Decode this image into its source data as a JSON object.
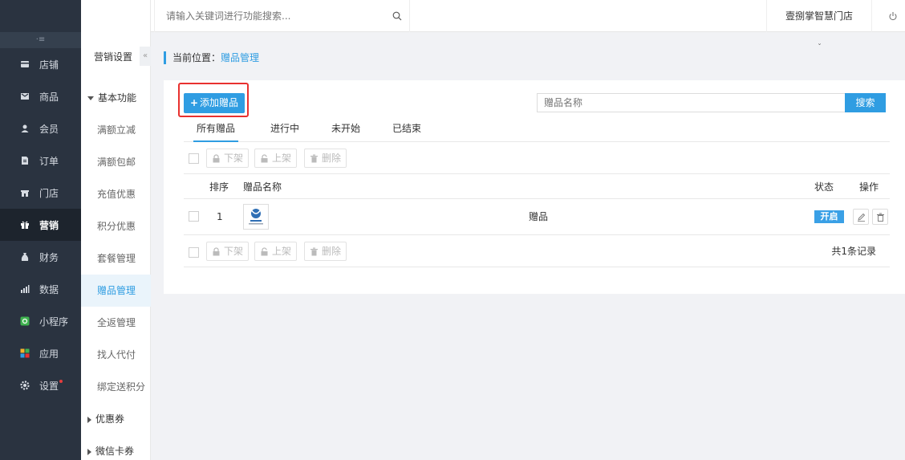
{
  "topbar": {
    "search_placeholder": "请输入关键词进行功能搜索...",
    "store_name": "壹捌掌智慧门店"
  },
  "sidebar": {
    "items": [
      {
        "label": "店铺",
        "icon": "store-icon"
      },
      {
        "label": "商品",
        "icon": "goods-icon"
      },
      {
        "label": "会员",
        "icon": "user-icon"
      },
      {
        "label": "订单",
        "icon": "order-icon"
      },
      {
        "label": "门店",
        "icon": "shop-icon"
      },
      {
        "label": "营销",
        "icon": "gift-icon",
        "active": true
      },
      {
        "label": "财务",
        "icon": "finance-icon"
      },
      {
        "label": "数据",
        "icon": "chart-icon"
      },
      {
        "label": "小程序",
        "icon": "miniprogram-icon"
      },
      {
        "label": "应用",
        "icon": "apps-icon"
      },
      {
        "label": "设置",
        "icon": "settings-icon",
        "has_dot": true
      }
    ]
  },
  "subnav": {
    "title": "营销设置",
    "group_basic": "基本功能",
    "items": [
      "满额立减",
      "满额包邮",
      "充值优惠",
      "积分优惠",
      "套餐管理",
      "赠品管理",
      "全返管理",
      "找人代付",
      "绑定送积分"
    ],
    "active_item": "赠品管理",
    "group_coupon": "优惠券",
    "group_wxcard": "微信卡券"
  },
  "breadcrumb": {
    "prefix": "当前位置：",
    "current": "赠品管理"
  },
  "actions": {
    "add_label": "添加赠品",
    "name_placeholder": "赠品名称",
    "search_label": "搜索"
  },
  "tabs": [
    "所有赠品",
    "进行中",
    "未开始",
    "已结束"
  ],
  "bulk": {
    "offline": "下架",
    "online": "上架",
    "delete": "删除"
  },
  "table": {
    "headers": {
      "sort": "排序",
      "name": "赠品名称",
      "status": "状态",
      "ops": "操作"
    },
    "rows": [
      {
        "sort": "1",
        "name": "赠品",
        "status": "开启"
      }
    ]
  },
  "footer": {
    "total": "共1条记录"
  },
  "colors": {
    "accent": "#2f9de2",
    "sidebar_bg": "#2a3340",
    "highlight_border": "#e8312f"
  }
}
